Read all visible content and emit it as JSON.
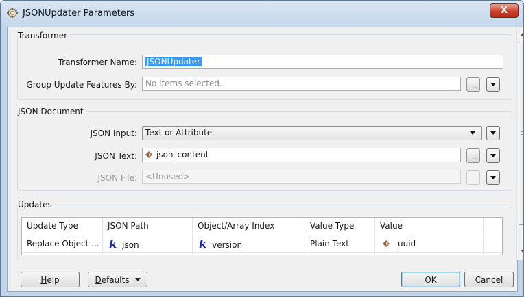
{
  "window": {
    "title": "JSONUpdater Parameters",
    "close_label": "X"
  },
  "transformer": {
    "group_title": "Transformer",
    "name_label": "Transformer Name:",
    "name_value": "JSONUpdater",
    "group_by_label": "Group Update Features By:",
    "group_by_placeholder": "No items selected.",
    "ellipsis_label": "..."
  },
  "json_document": {
    "group_title": "JSON Document",
    "input_label": "JSON Input:",
    "input_value": "Text or Attribute",
    "text_label": "JSON Text:",
    "text_value": "json_content",
    "file_label": "JSON File:",
    "file_value": "<Unused>",
    "ellipsis_label": "..."
  },
  "updates": {
    "group_title": "Updates",
    "columns": [
      "Update Type",
      "JSON Path",
      "Object/Array Index",
      "Value Type",
      "Value"
    ],
    "rows": [
      {
        "update_type": "Replace Object ...",
        "json_path": "json",
        "object_index": "version",
        "value_type": "Plain Text",
        "value": "_uuid"
      }
    ]
  },
  "buttons": {
    "help": {
      "prefix": "",
      "accel": "H",
      "rest": "elp"
    },
    "defaults": {
      "prefix": "",
      "accel": "D",
      "rest": "efaults"
    },
    "ok": "OK",
    "cancel": "Cancel"
  },
  "icons": {
    "app": "fme-transformer-icon",
    "attribute": "attribute-diamond-icon",
    "expression": "k-expression-icon"
  },
  "colors": {
    "selection": "#3399ff",
    "close_button": "#c9432c",
    "expression_icon": "#1b2cb3",
    "attribute_icon": "#7a5a3a"
  }
}
